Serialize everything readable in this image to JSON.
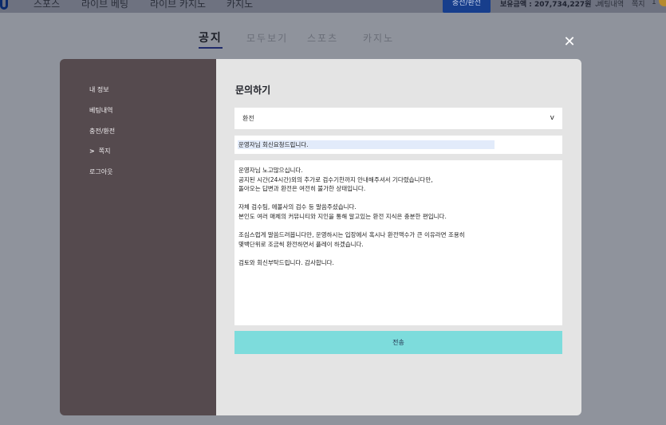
{
  "topnav": {
    "logo_icon": "logo-mark-icon",
    "items": [
      "스포스",
      "라이브 베팅",
      "라이브 카지노",
      "카지노"
    ],
    "charge_button": "충전/환전",
    "balance": "보유금액 : 207,734,227원",
    "betting_history": "베팅내역",
    "note": "쪽지",
    "count": "1"
  },
  "tabs": [
    {
      "label": "공지",
      "active": true
    },
    {
      "label": "모두보기",
      "active": false
    },
    {
      "label": "스포츠",
      "active": false
    },
    {
      "label": "카지노",
      "active": false
    }
  ],
  "sidebar": {
    "items": [
      {
        "label": "내 정보"
      },
      {
        "label": "베팅내역"
      },
      {
        "label": "충전/환전"
      },
      {
        "label": "쪽지",
        "active": true
      },
      {
        "label": "로그아웃"
      }
    ],
    "active_marker": ">"
  },
  "form": {
    "title": "문의하기",
    "category_value": "환전",
    "chevron": "v",
    "subject": "운영자님 회신요청드립니다.",
    "body": "운영자님 노고많으십니다.\n공지된 시간(24시간)외의 추가로 검수기한까지 안내해주셔서 기다렸습니다만,\n돌아오는 답변과 환전은 여전히 불가한 상태입니다.\n\n자체 검수팀, 에볼사의 검수 등 말씀주셨습니다.\n본인도 여러 매체의 커뮤니티와 지인을 통해 알고있는 환전 지식은 충분한 편입니다.\n\n조심스럽게 말씀드려봅니다만, 운영하시는 입장에서 혹시나 환전액수가 큰 이유라면 조용히\n몇백단위로 조금씩 환전하면서 플레이 하겠습니다.\n\n검토와 회신부탁드립니다. 감사합니다.",
    "submit_label": "전송"
  },
  "colors": {
    "overlay": "#8f939c",
    "sidebar_bg": "#554a4e",
    "panel_bg": "#e4e4e4",
    "submit_bg": "#7ddcdc",
    "charge_btn": "#173e8c"
  }
}
